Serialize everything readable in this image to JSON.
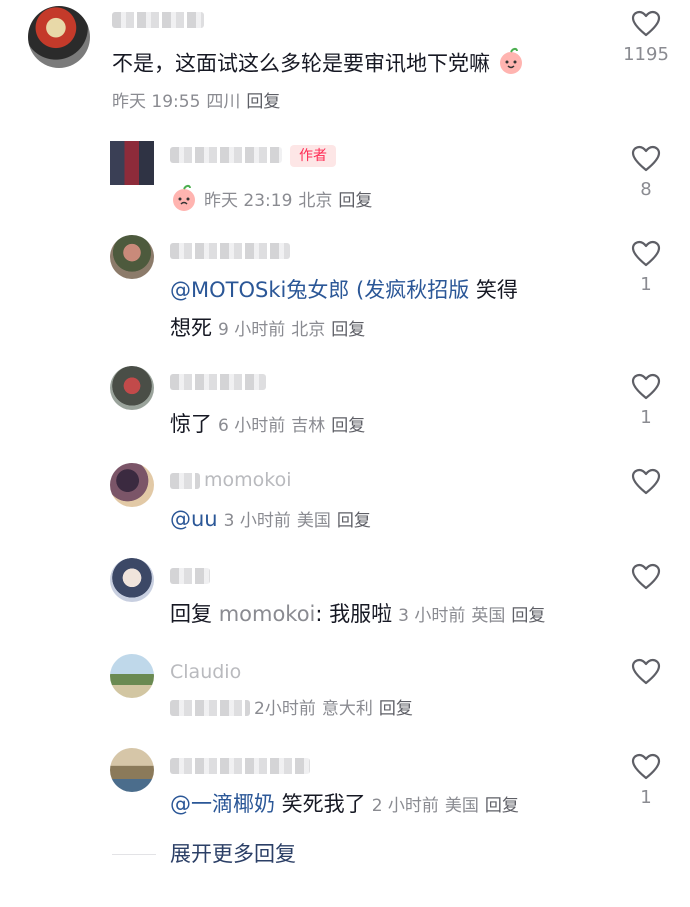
{
  "main_comment": {
    "text": "不是，这面试这么多轮是要审讯地下党嘛",
    "time": "昨天 19:55",
    "location": "四川",
    "reply": "回复",
    "likes": "1195"
  },
  "replies": [
    {
      "author_tag": "作者",
      "time": "昨天 23:19",
      "location": "北京",
      "reply": "回复",
      "likes": "8"
    },
    {
      "mention": "@MOTOSki兔女郎 (发疯秋招版",
      "text_after": " 笑得",
      "text_line2": "想死",
      "time": "9 小时前",
      "location": "北京",
      "reply": "回复",
      "likes": "1"
    },
    {
      "text": "惊了",
      "time": "6 小时前",
      "location": "吉林",
      "reply": "回复",
      "likes": "1"
    },
    {
      "name": "momokoi",
      "mention": "@uu",
      "time": "3 小时前",
      "location": "美国",
      "reply": "回复",
      "likes": ""
    },
    {
      "prefix": "回复",
      "reply_to": "momokoi",
      "text": ": 我服啦",
      "time": "3 小时前",
      "location": "英国",
      "reply": "回复",
      "likes": ""
    },
    {
      "name": "Claudio",
      "time": "2小时前",
      "location": "意大利",
      "reply": "回复",
      "likes": ""
    },
    {
      "mention": "@一滴椰奶",
      "text": " 笑死我了",
      "time": "2 小时前",
      "location": "美国",
      "reply": "回复",
      "likes": "1"
    }
  ],
  "expand_label": "展开更多回复",
  "colors": {
    "mention": "#2b5797",
    "meta": "#8a8b91",
    "author_tag": "#fe2c55"
  }
}
